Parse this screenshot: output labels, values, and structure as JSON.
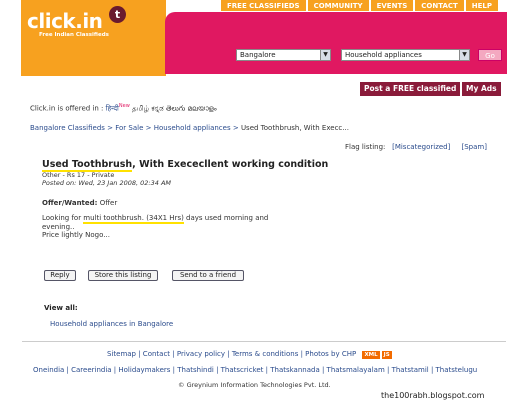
{
  "header": {
    "logo_text": "click.in",
    "logo_badge": "t",
    "tagline": "Free Indian Classifieds",
    "tabs": [
      "FREE CLASSIFIEDS",
      "COMMUNITY",
      "EVENTS",
      "CONTACT",
      "HELP"
    ],
    "city_select": "Bangalore",
    "category_select": "Household appliances",
    "go_label": "Go"
  },
  "actions": {
    "post_label": "Post a FREE classified",
    "my_ads_label": "My Ads"
  },
  "languages": {
    "prefix": "Click.in is offered in :",
    "list": "हिन्दी",
    "new_badge": "New",
    "others": "தமிழ் ಕನ್ನಡ తెలుగు മലയാളം"
  },
  "breadcrumb": {
    "links": [
      "Bangalore Classifieds",
      "For Sale",
      "Household appliances"
    ],
    "current": "Used Toothbrush, With Execc..."
  },
  "flag": {
    "label": "Flag listing:",
    "opt1": "[Miscategorized]",
    "opt2": "[Spam]"
  },
  "listing": {
    "title_hl": "Used Toothbrush",
    "title_rest": ", With Exececllent working condition",
    "meta1": "Other - Rs 17 - Private",
    "meta2_label": "Posted on:",
    "meta2_value": " Wed, 23 Jan 2008, 02:34 AM",
    "offer_label": "Offer/Wanted:",
    "offer_value": " Offer",
    "desc_pre": "Looking for ",
    "desc_hl": "multi toothbrush. (34X1 Hrs)",
    "desc_post": " days used morning and evening..",
    "desc_line3": "Price lightly Nogo..."
  },
  "buttons": {
    "reply": "Reply",
    "store": "Store this listing",
    "send": "Send to a friend"
  },
  "view_all": {
    "label": "View all:",
    "link": "Household appliances in Bangalore"
  },
  "footer": {
    "links1": "Sitemap | Contact | Privacy policy | Terms & conditions | Photos by CHP",
    "xml_badge": "XML",
    "js_badge": "JS",
    "links2": "Oneindia | Careerindia | Holidaymakers | Thatshindi | Thatscricket | Thatskannada | Thatsmalayalam | Thatstamil | Thatstelugu",
    "copyright": "© Greynium Information Technologies Pvt. Ltd."
  },
  "watermark": "the100rabh.blogspot.com"
}
